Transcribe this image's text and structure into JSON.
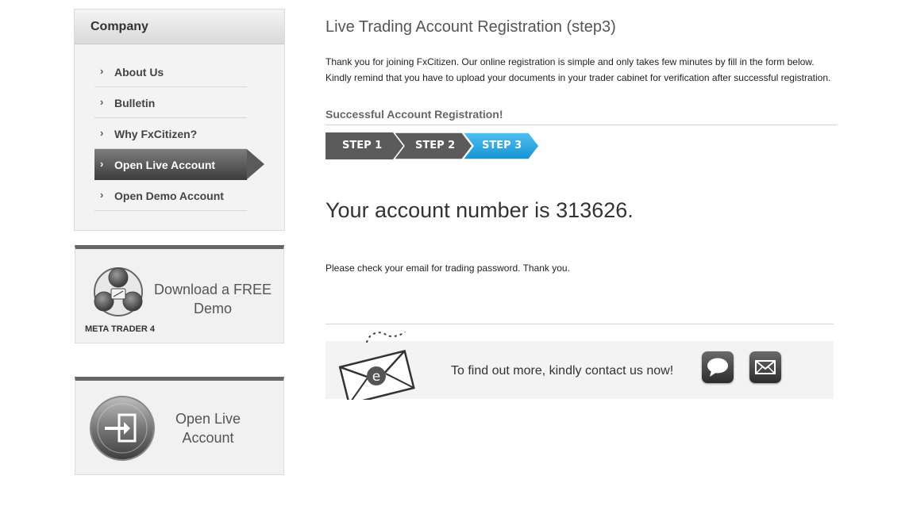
{
  "sidebar": {
    "title": "Company",
    "items": [
      {
        "label": "About Us"
      },
      {
        "label": "Bulletin"
      },
      {
        "label": "Why FxCitizen?"
      },
      {
        "label": "Open Live Account"
      },
      {
        "label": "Open Demo Account"
      }
    ],
    "active_item": "Open Live Account",
    "chevron_icon": "chevron-right-icon",
    "promo_demo": {
      "logo_icon": "metatrader-logo-icon",
      "caption": "META TRADER 4",
      "line1": "Download a FREE",
      "line2": "Demo"
    },
    "promo_live": {
      "icon": "login-arrow-icon",
      "line1": "Open Live",
      "line2": "Account"
    }
  },
  "main": {
    "title": "Live Trading Account Registration (step3)",
    "intro_line1": "Thank you for joining FxCitizen. Our online registration is simple and only takes few minutes by fill in the form below.",
    "intro_line2": "Kindly remind that you have to upload your documents in your trader cabinet for verification after successful registration.",
    "success_heading": "Successful Account Registration!",
    "steps": [
      {
        "label": "STEP 1",
        "state": "done"
      },
      {
        "label": "STEP 2",
        "state": "done"
      },
      {
        "label": "STEP 3",
        "state": "current"
      }
    ],
    "account_text": "Your account number is 313626.",
    "check_email_text": "Please check your email for trading password. Thank you.",
    "contact": {
      "envelope_icon": "email-envelope-icon",
      "text": "To find out more, kindly contact us now!",
      "chat_icon": "chat-bubble-icon",
      "mail_icon": "mail-icon"
    }
  },
  "colors": {
    "step_done": "#5b5b5b",
    "step_current": "#1ba3e0",
    "active_menu": "#4a4a4a",
    "promo_border": "#666666"
  }
}
